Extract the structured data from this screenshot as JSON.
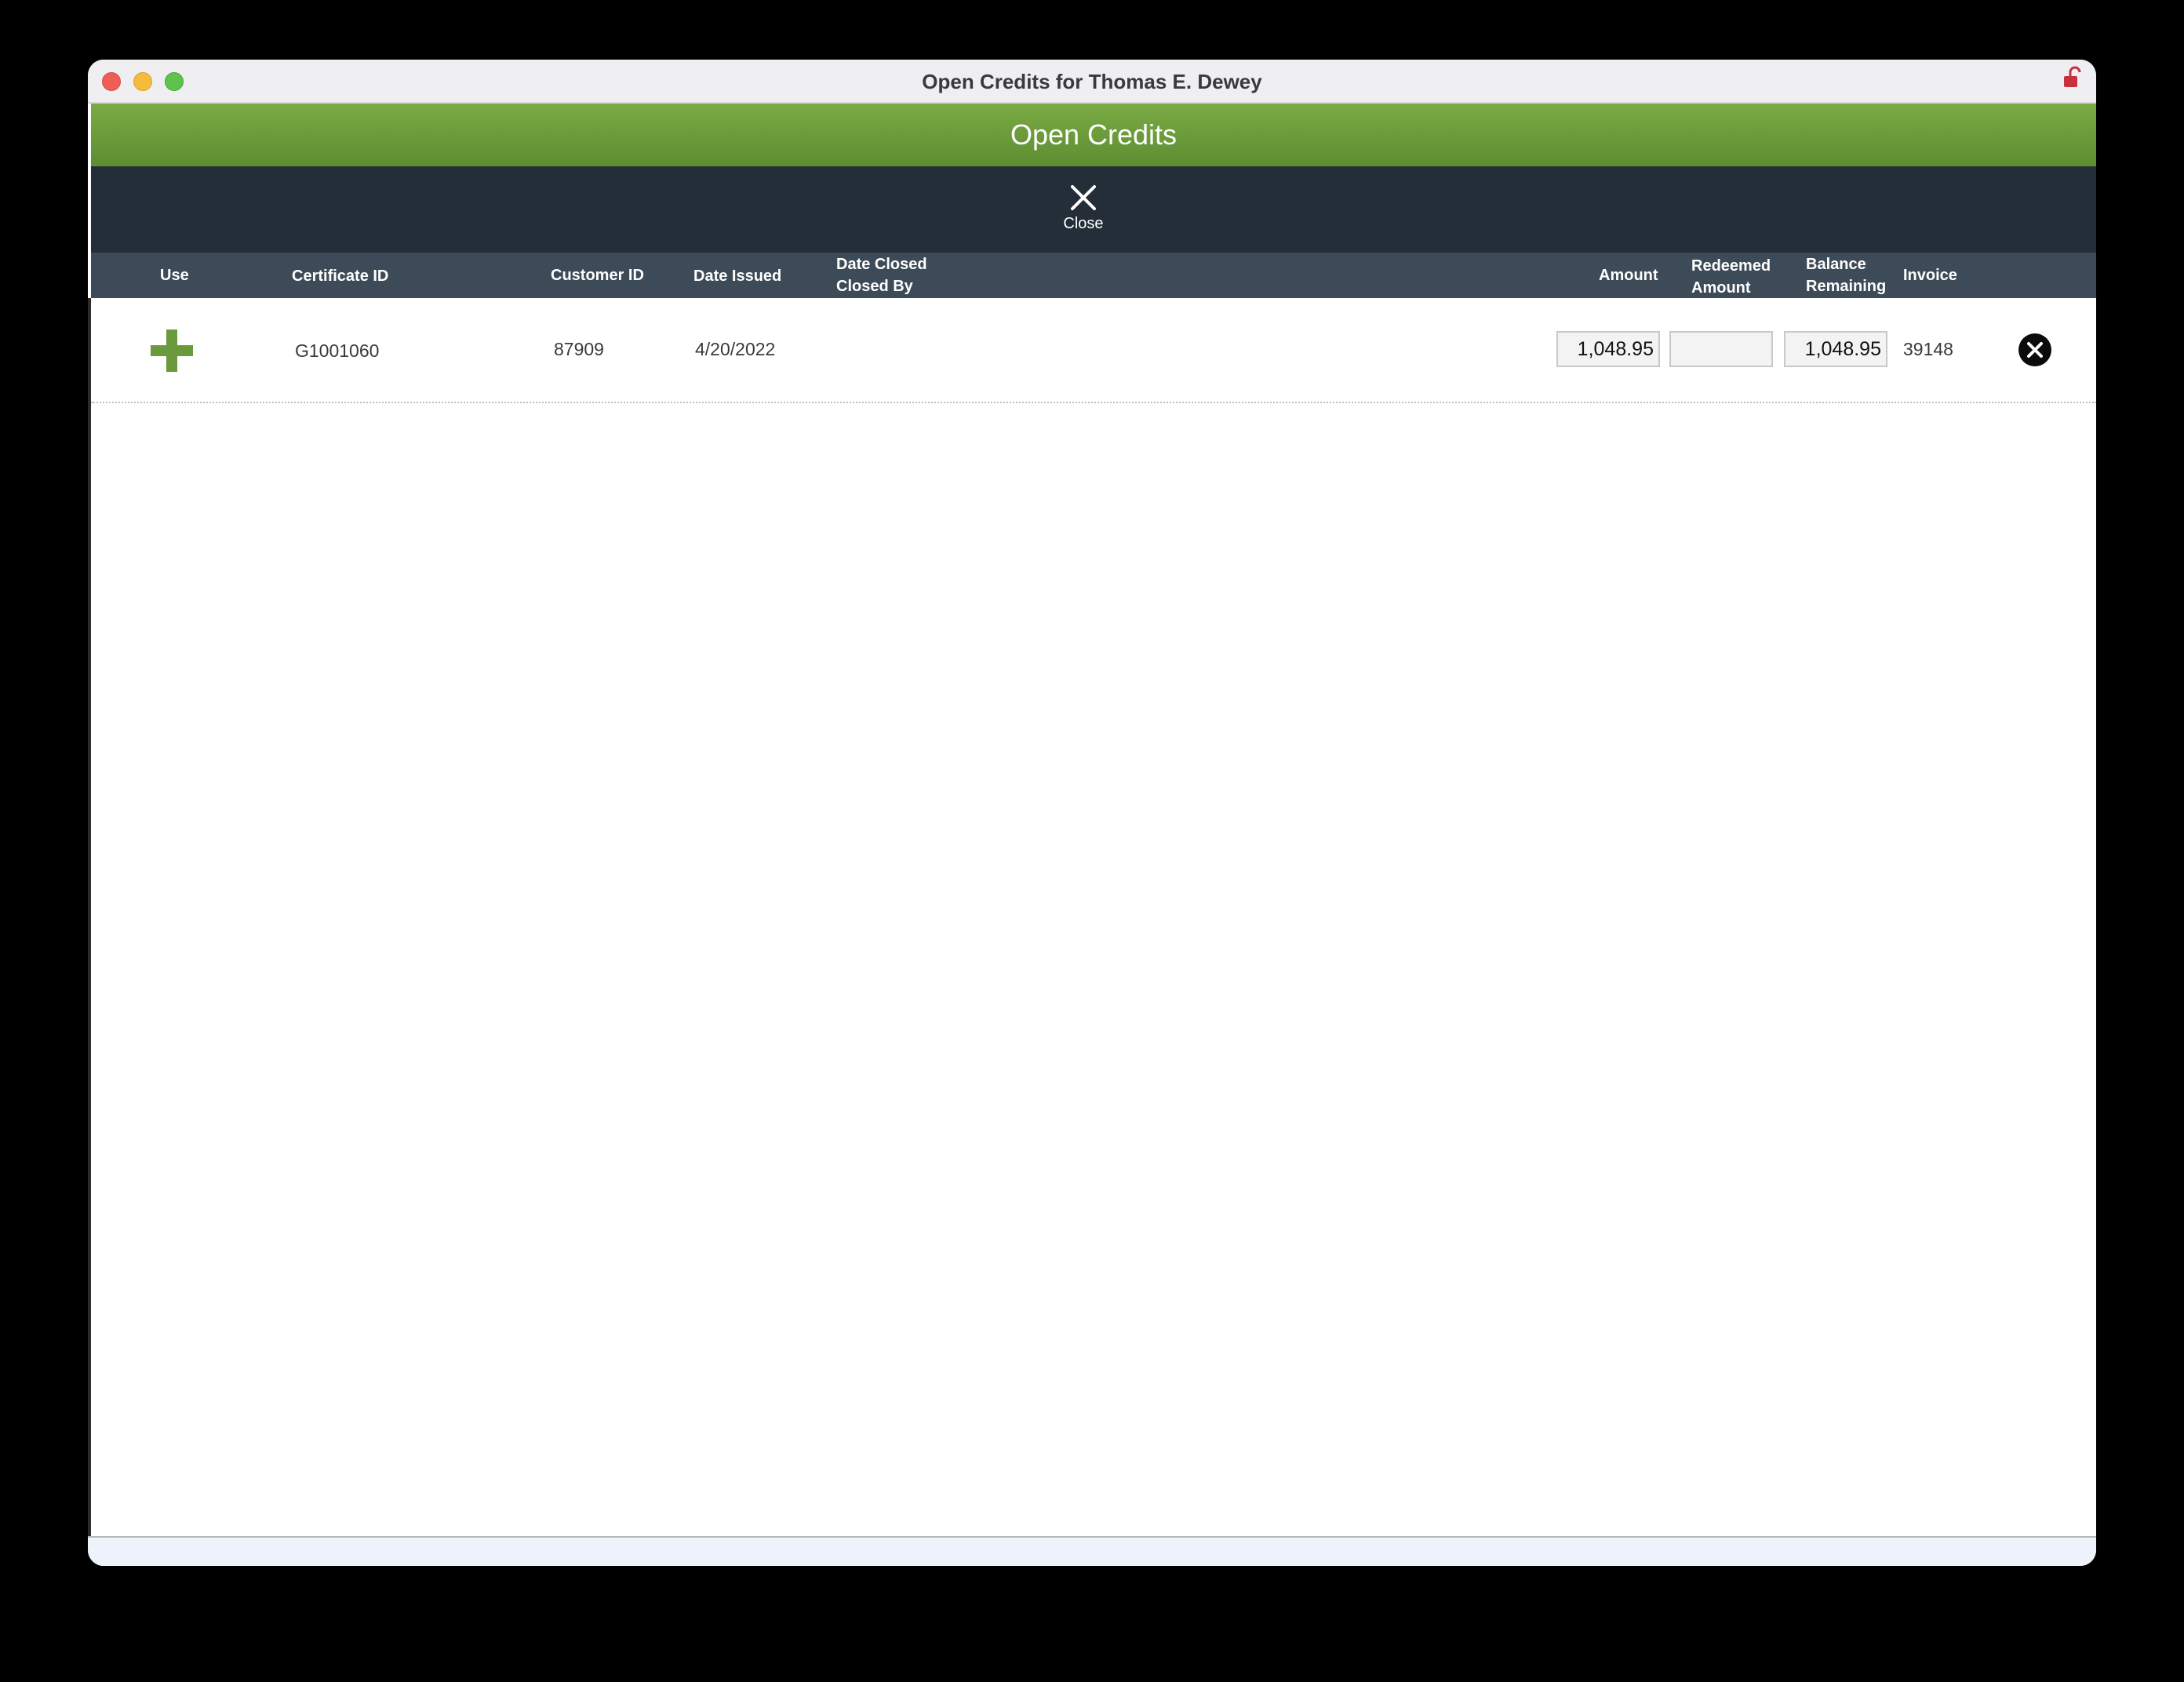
{
  "window": {
    "title": "Open Credits for Thomas E.  Dewey"
  },
  "header": {
    "title": "Open Credits"
  },
  "toolbar": {
    "close_label": "Close"
  },
  "columns": {
    "use": "Use",
    "certificate_id": "Certificate ID",
    "customer_id": "Customer ID",
    "date_issued": "Date Issued",
    "date_closed": "Date Closed",
    "closed_by": "Closed By",
    "amount": "Amount",
    "redeemed_line1": "Redeemed",
    "redeemed_line2": "Amount",
    "balance_line1": "Balance",
    "balance_line2": "Remaining",
    "invoice": "Invoice"
  },
  "rows": [
    {
      "certificate_id": "G1001060",
      "customer_id": "87909",
      "date_issued": "4/20/2022",
      "date_closed": "",
      "closed_by": "",
      "amount": "1,048.95",
      "redeemed_amount": "",
      "balance_remaining": "1,048.95",
      "invoice": "39148"
    }
  ],
  "icons": {
    "use": "plus-icon",
    "delete": "circle-x-icon",
    "close": "close-icon",
    "lock": "lock-icon"
  },
  "colors": {
    "header_green": "#6c9c3b",
    "toolbar_dark": "#232e38",
    "column_header": "#3d4a57",
    "plus_green": "#6a9a3c"
  }
}
